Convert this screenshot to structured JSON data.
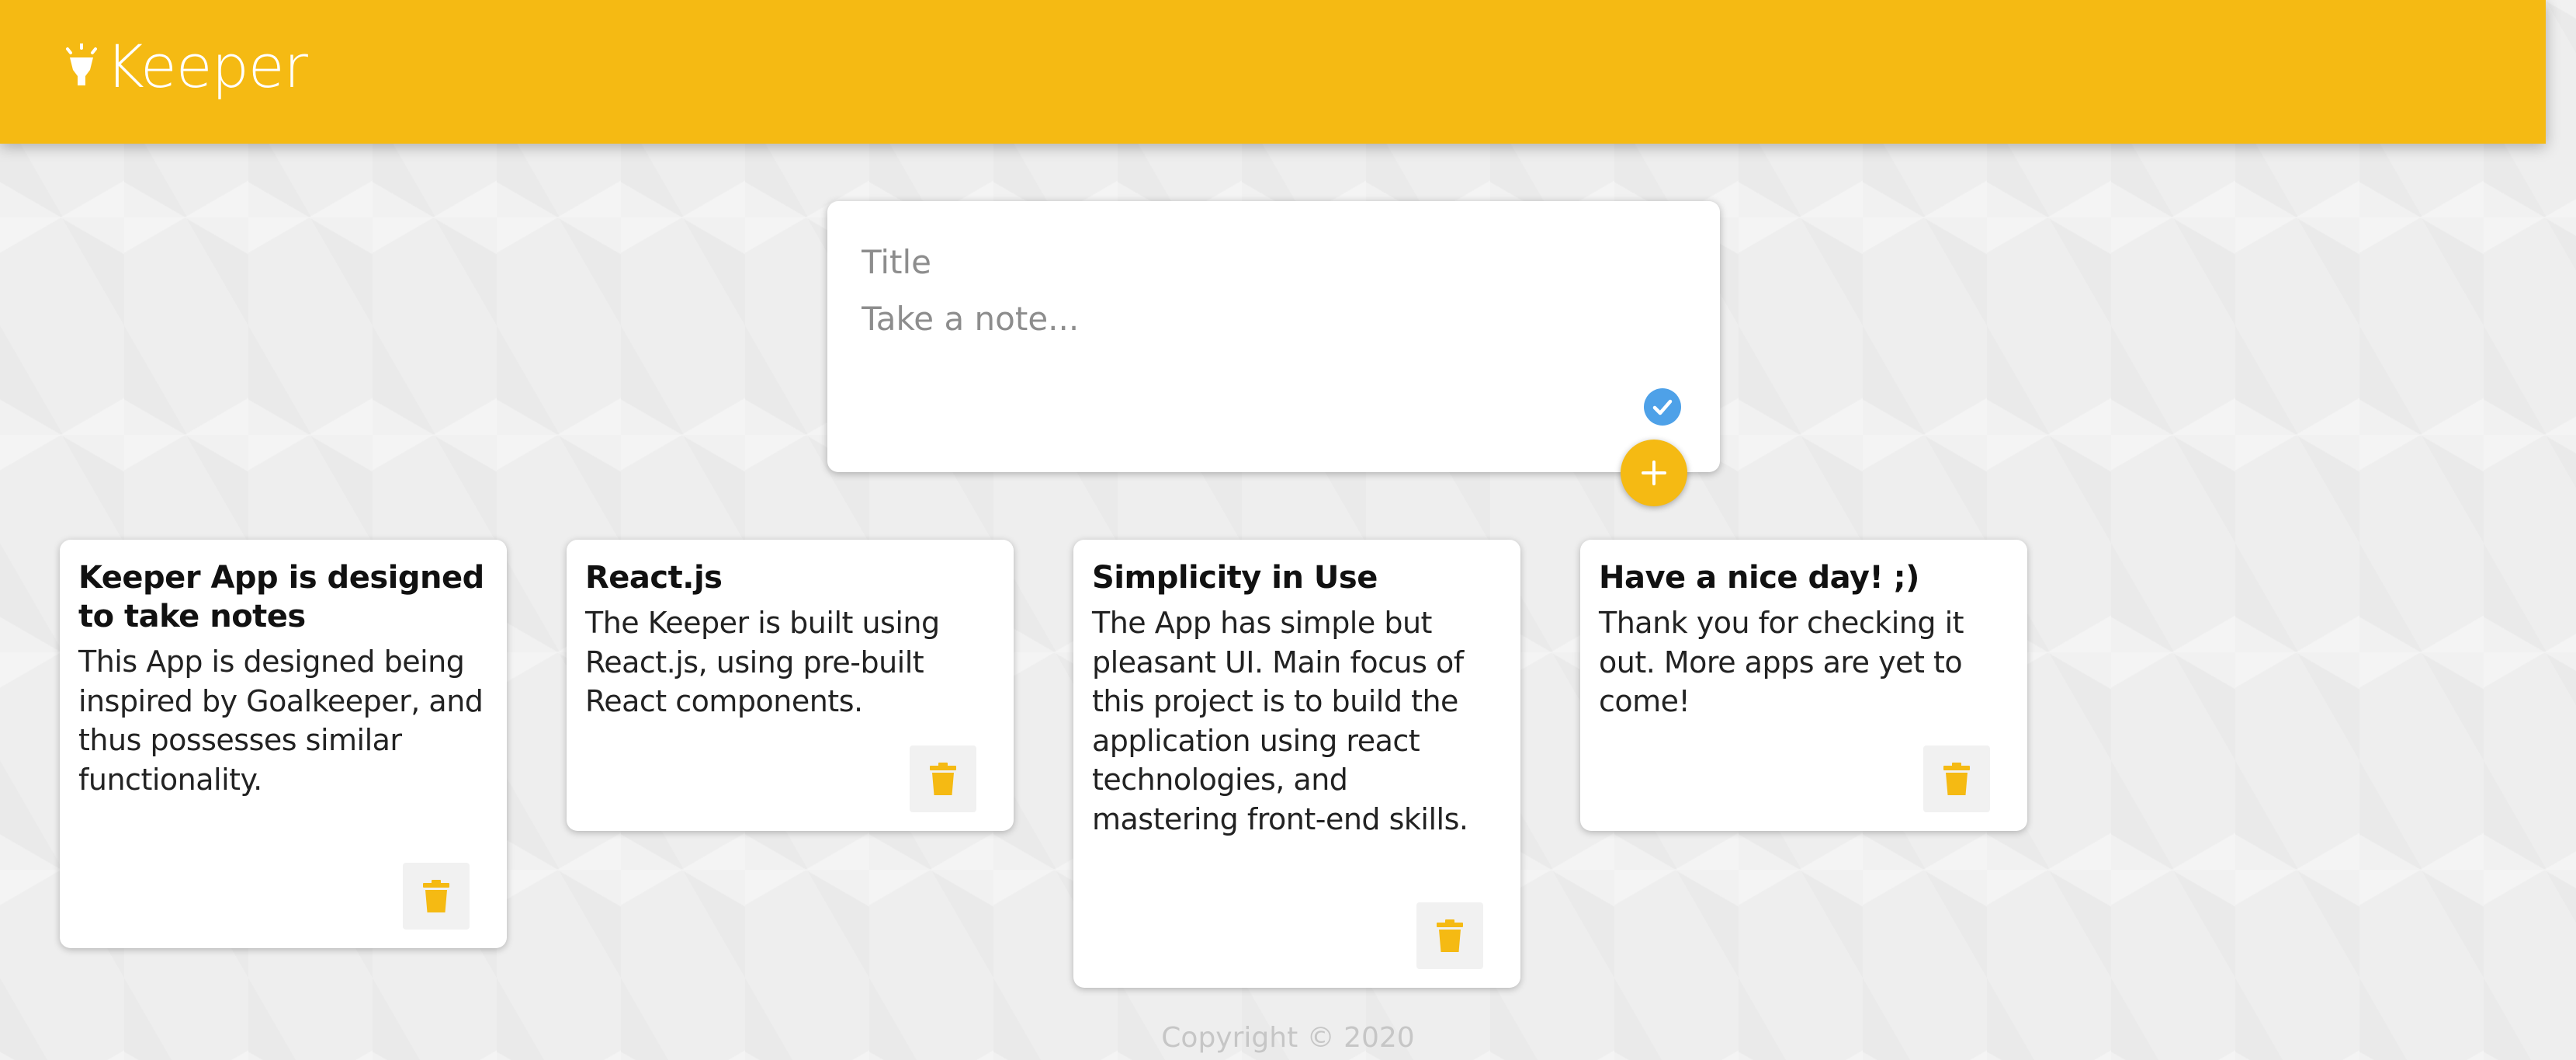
{
  "colors": {
    "accent": "#f5ba13",
    "check_badge": "#4ea1e8",
    "background": "#eeeeee"
  },
  "header": {
    "app_name": "Keeper",
    "logo_icon": "lightbulb-highlight-icon"
  },
  "create_note": {
    "title_placeholder": "Title",
    "content_placeholder": "Take a note...",
    "check_icon": "check-circle-icon",
    "add_icon": "plus-icon"
  },
  "notes": [
    {
      "title": "Keeper App is designed to take notes",
      "content": "This App is designed being inspired by Goalkeeper, and thus possesses similar functionality.",
      "delete_icon": "trash-icon"
    },
    {
      "title": "React.js",
      "content": "The Keeper is built using React.js, using pre-built React components.",
      "delete_icon": "trash-icon"
    },
    {
      "title": "Simplicity in Use",
      "content": "The App has simple but pleasant UI. Main focus of this project is to build the application using react technologies, and mastering front-end skills.",
      "delete_icon": "trash-icon"
    },
    {
      "title": "Have a nice day! ;)",
      "content": "Thank you for checking it out. More apps are yet to come!",
      "delete_icon": "trash-icon"
    }
  ],
  "footer": {
    "copyright": "Copyright © 2020"
  }
}
